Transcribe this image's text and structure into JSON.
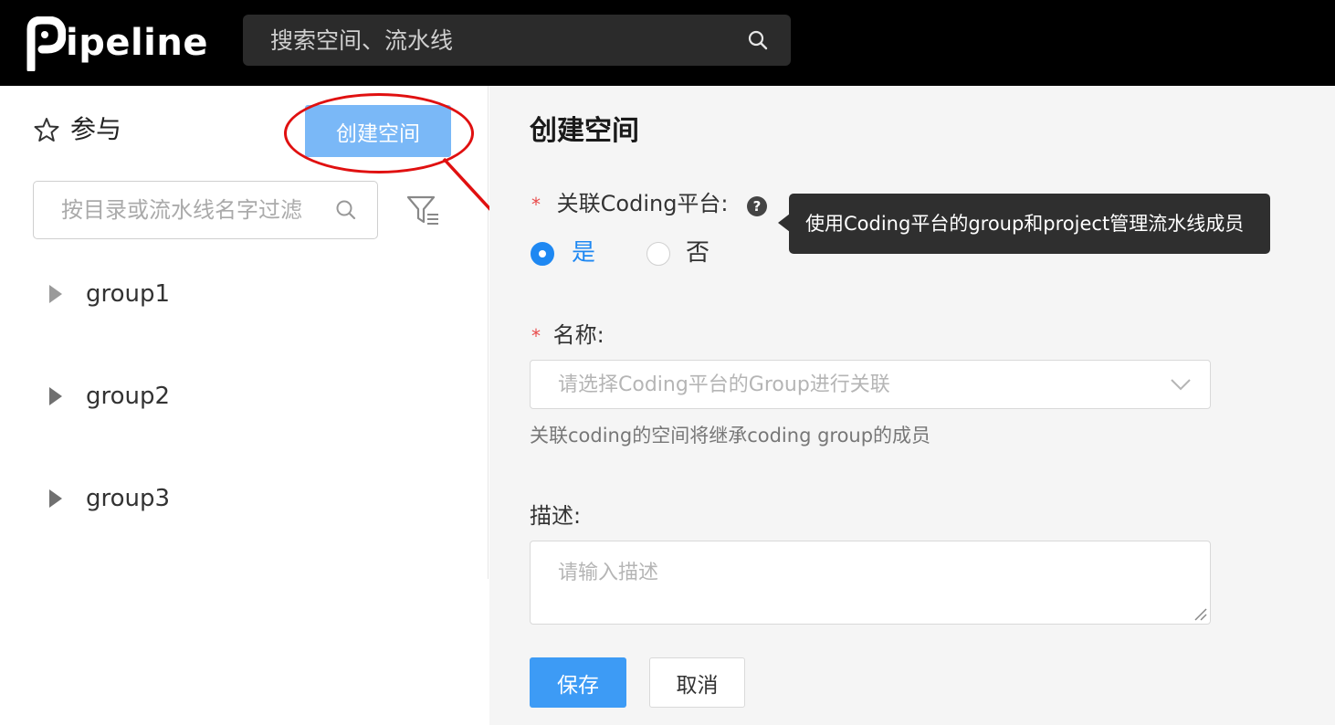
{
  "header": {
    "logo_text": "ipeline",
    "search_placeholder": "搜索空间、流水线"
  },
  "sidebar": {
    "section_title": "参与",
    "create_button_label": "创建空间",
    "filter_placeholder": "按目录或流水线名字过滤",
    "groups": [
      {
        "label": "group1"
      },
      {
        "label": "group2"
      },
      {
        "label": "group3"
      }
    ]
  },
  "form": {
    "title": "创建空间",
    "coding_label": "关联Coding平台:",
    "required_mark": "*",
    "tooltip": "使用Coding平台的group和project管理流水线成员",
    "radio_yes": "是",
    "radio_no": "否",
    "selected_option": "是",
    "name_label": "名称:",
    "name_select_placeholder": "请选择Coding平台的Group进行关联",
    "name_hint": "关联coding的空间将继承coding group的成员",
    "desc_label": "描述:",
    "desc_placeholder": "请输入描述",
    "save_label": "保存",
    "cancel_label": "取消"
  },
  "colors": {
    "topbar": "#000000",
    "primary": "#3d9bf5",
    "primary_light": "#7ab8f7",
    "annotation_red": "#e01010",
    "required_red": "#e84a4a"
  }
}
